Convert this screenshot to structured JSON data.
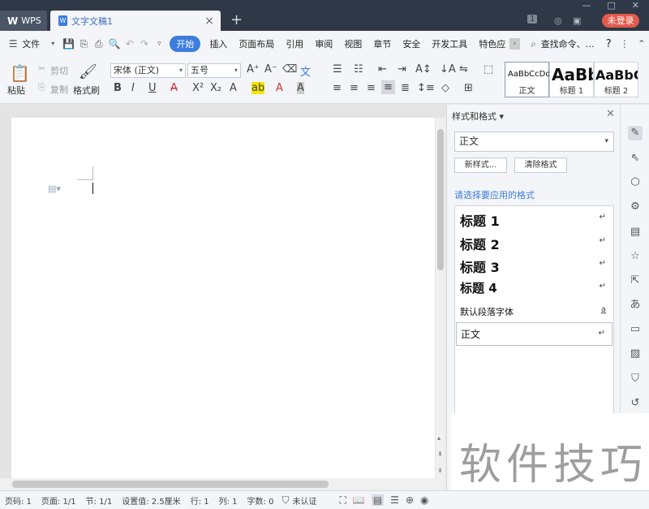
{
  "titlebar": {
    "app_tab": "WPS",
    "doc_tab": "文字文稿1",
    "login": "未登录",
    "badge": "1"
  },
  "menu": {
    "file": "文件",
    "items": [
      "开始",
      "插入",
      "页面布局",
      "引用",
      "审阅",
      "视图",
      "章节",
      "安全",
      "开发工具",
      "特色应"
    ],
    "search": "查找命令、…",
    "help": "?"
  },
  "ribbon": {
    "paste": "粘贴",
    "cut": "剪切",
    "copy": "复制",
    "format_painter": "格式刷",
    "font_name": "宋体 (正文)",
    "font_size": "五号",
    "styles": [
      {
        "sample": "AaBbCcDd",
        "caption": "正文"
      },
      {
        "sample": "AaBb",
        "caption": "标题 1"
      },
      {
        "sample": "AaBbC",
        "caption": "标题 2"
      }
    ]
  },
  "panel": {
    "title": "样式和格式",
    "current_style": "正文",
    "new_style": "新样式...",
    "clear_format": "清除格式",
    "choose_label": "请选择要应用的格式",
    "items": [
      {
        "name": "标题  1",
        "mark": "↵"
      },
      {
        "name": "标题  2",
        "mark": "↵"
      },
      {
        "name": "标题  3",
        "mark": "↵"
      },
      {
        "name": "标题  4",
        "mark": "↵"
      },
      {
        "name": "默认段落字体",
        "mark": "a"
      },
      {
        "name": "正文",
        "mark": "↵"
      }
    ]
  },
  "status": {
    "page_num": "页码: 1",
    "page": "页面: 1/1",
    "section": "节: 1/1",
    "setting": "设置值: 2.5厘米",
    "row": "行: 1",
    "col": "列: 1",
    "words": "字数: 0",
    "auth": "未认证"
  },
  "watermark": "软件技巧",
  "colors": {
    "accent": "#3d7cdc",
    "titlebar": "#2f3846",
    "login": "#e25a4d"
  }
}
